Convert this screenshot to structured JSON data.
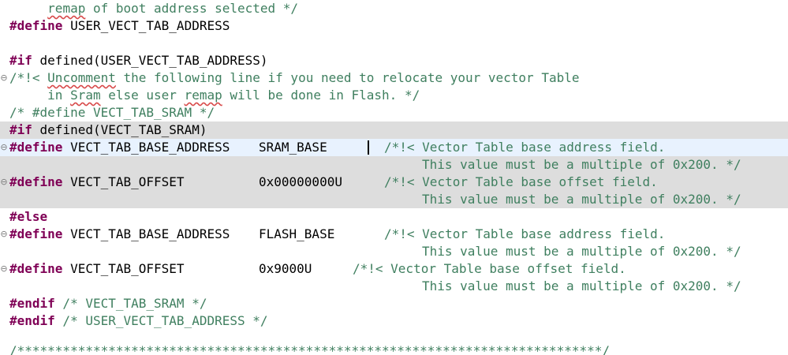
{
  "editor": {
    "lines": {
      "l1": {
        "indent": "     ",
        "pre": "",
        "spell1": "remap",
        "post": " of boot address selected */"
      },
      "l2": {
        "kw": "#define",
        "rest": " USER_VECT_TAB_ADDRESS"
      },
      "l4": {
        "kw": "#if",
        "rest": " defined(USER_VECT_TAB_ADDRESS)"
      },
      "l5": {
        "pre": "/*!< ",
        "spell1": "Uncomment",
        "post": " the following line if you need to relocate your vector Table"
      },
      "l6": {
        "indent": "     ",
        "pre": "in ",
        "spell1": "Sram",
        "mid": " else user ",
        "spell2": "remap",
        "post": " will be done in Flash. */"
      },
      "l7": {
        "text": "/* #define VECT_TAB_SRAM */"
      },
      "l8": {
        "kw": "#if",
        "rest": " defined(VECT_TAB_SRAM)"
      },
      "l9": {
        "kw": "#define",
        "name": " VECT_TAB_BASE_ADDRESS",
        "value": "SRAM_BASE",
        "comment": "/*!< Vector Table base address field."
      },
      "l10": {
        "comment": "This value must be a multiple of 0x200. */"
      },
      "l11": {
        "kw": "#define",
        "name": " VECT_TAB_OFFSET",
        "value": "0x00000000U",
        "comment": "/*!< Vector Table base offset field."
      },
      "l12": {
        "comment": "This value must be a multiple of 0x200. */"
      },
      "l13": {
        "kw": "#else"
      },
      "l14": {
        "kw": "#define",
        "name": " VECT_TAB_BASE_ADDRESS",
        "value": "FLASH_BASE",
        "comment": "/*!< Vector Table base address field."
      },
      "l15": {
        "comment": "This value must be a multiple of 0x200. */"
      },
      "l16": {
        "kw": "#define",
        "name": " VECT_TAB_OFFSET",
        "value": "0x9000U",
        "comment": "/*!< Vector Table base offset field."
      },
      "l17": {
        "comment": "This value must be a multiple of 0x200. */"
      },
      "l18": {
        "kw": "#endif",
        "comment": " /* VECT_TAB_SRAM */"
      },
      "l19": {
        "kw": "#endif",
        "comment": " /* USER_VECT_TAB_ADDRESS */"
      },
      "l21": {
        "text": "/*****************************************************************************/"
      }
    },
    "fold_marker": "⊖"
  }
}
